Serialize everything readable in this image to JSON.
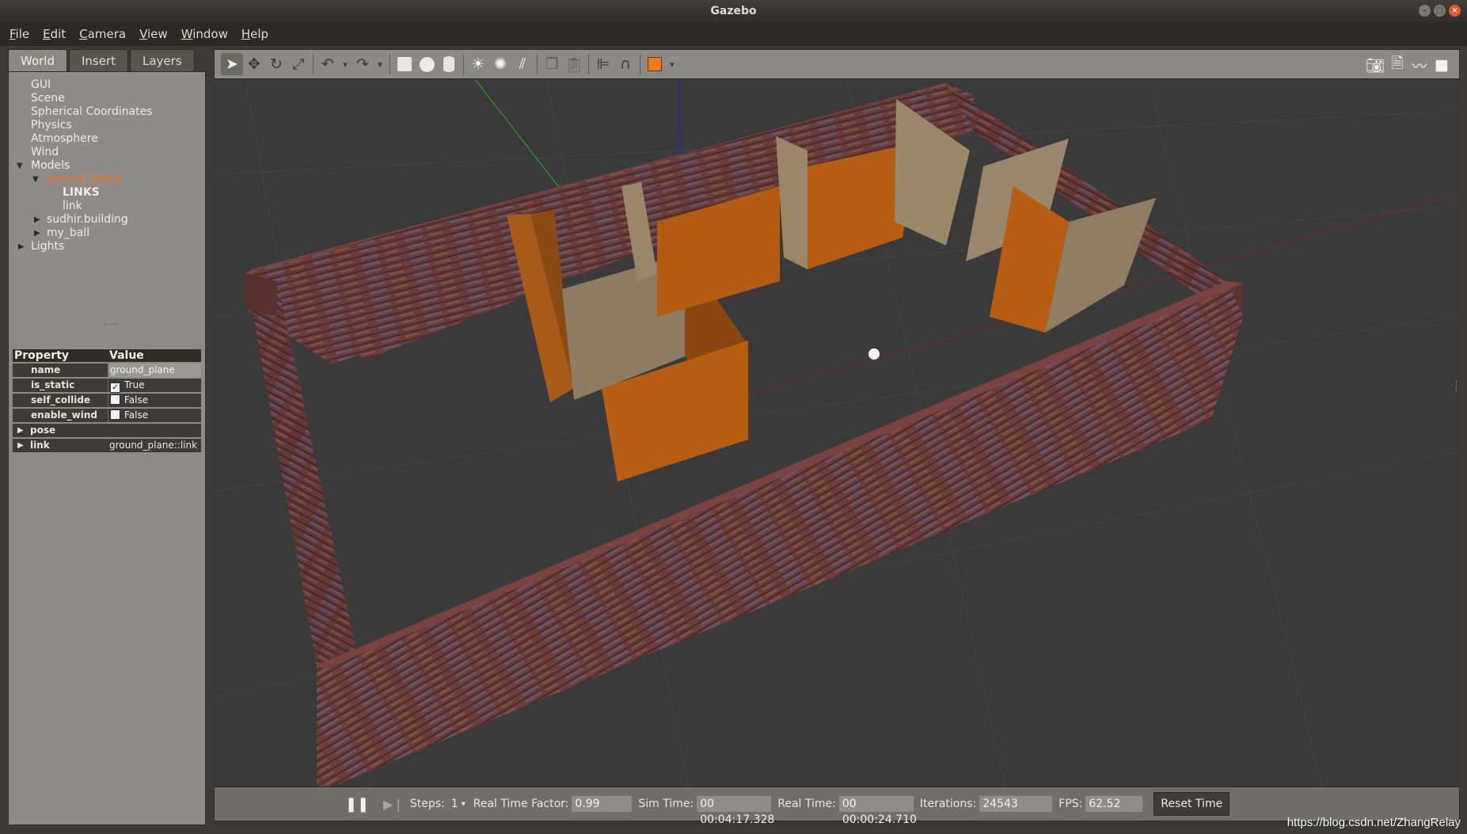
{
  "window": {
    "title": "Gazebo"
  },
  "menubar": {
    "items": [
      {
        "key": "F",
        "rest": "ile"
      },
      {
        "key": "E",
        "rest": "dit"
      },
      {
        "key": "C",
        "rest": "amera"
      },
      {
        "key": "V",
        "rest": "iew"
      },
      {
        "key": "W",
        "rest": "indow"
      },
      {
        "key": "H",
        "rest": "elp"
      }
    ]
  },
  "left_panel": {
    "tabs": [
      "World",
      "Insert",
      "Layers"
    ],
    "tree": {
      "gui": "GUI",
      "scene": "Scene",
      "spherical": "Spherical Coordinates",
      "physics": "Physics",
      "atmosphere": "Atmosphere",
      "wind": "Wind",
      "models": "Models",
      "ground_plane": "ground_plane",
      "links": "LINKS",
      "link": "link",
      "building": "sudhir.building",
      "ball": "my_ball",
      "lights": "Lights"
    },
    "properties": {
      "header": {
        "col1": "Property",
        "col2": "Value"
      },
      "name": {
        "label": "name",
        "value": "ground_plane"
      },
      "is_static": {
        "label": "is_static",
        "value": "True",
        "checked": true
      },
      "self_collide": {
        "label": "self_collide",
        "value": "False",
        "checked": false
      },
      "enable_wind": {
        "label": "enable_wind",
        "value": "False",
        "checked": false
      },
      "pose": {
        "label": "pose"
      },
      "link": {
        "label": "link",
        "value": "ground_plane::link"
      }
    }
  },
  "toolbar": {
    "tools": [
      "select-icon",
      "translate-icon",
      "rotate-icon",
      "scale-icon",
      "undo-icon",
      "redo-icon",
      "box-icon",
      "sphere-icon",
      "cylinder-icon",
      "point-light-icon",
      "spot-light-icon",
      "directional-light-icon",
      "copy-icon",
      "paste-icon",
      "align-icon",
      "snap-icon",
      "view-angle-icon"
    ],
    "right_tools": [
      "screenshot-icon",
      "log-icon",
      "plot-icon",
      "record-video-icon"
    ]
  },
  "statusbar": {
    "steps_label": "Steps:",
    "steps_value": "1",
    "rtf_label": "Real Time Factor:",
    "rtf_value": "0.99",
    "sim_time_label": "Sim Time:",
    "sim_time_value": "00 00:04:17.328",
    "real_time_label": "Real Time:",
    "real_time_value": "00 00:00:24.710",
    "iterations_label": "Iterations:",
    "iterations_value": "24543",
    "fps_label": "FPS:",
    "fps_value": "62.52",
    "reset_label": "Reset Time"
  },
  "watermark": "https://blog.csdn.net/ZhangRelay",
  "colors": {
    "accent_orange": "#f47421",
    "brick_wall": "#6a3a37",
    "orange_wall": "#b45a10",
    "beige_wall": "#8f7e63"
  }
}
